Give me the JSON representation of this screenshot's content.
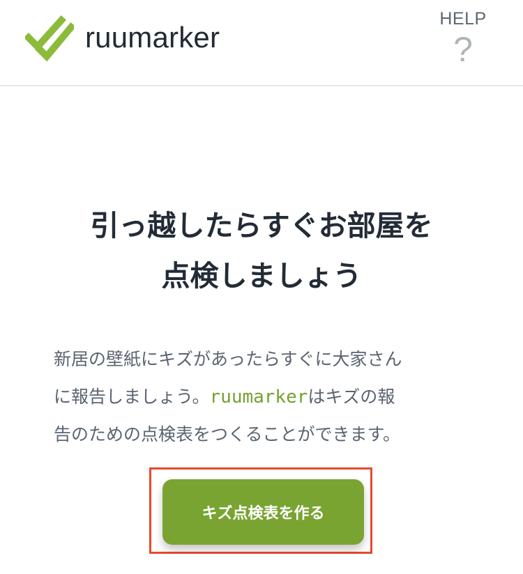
{
  "header": {
    "logo_text": "ruumarker",
    "logo_icon": "double-check-icon",
    "help_label": "HELP",
    "help_icon_text": "?",
    "help_icon": "question-mark-icon"
  },
  "hero": {
    "heading_lines": [
      "引っ越したらすぐお部屋を",
      "点検しましょう"
    ],
    "description": {
      "line1": "新居の壁紙にキズがあったらすぐに大家さん",
      "line2_prefix": "に報告しましょう。",
      "line2_brand": "ruumarker",
      "line2_suffix": "はキズの報",
      "line3": "告のための点検表をつくることができます。"
    },
    "cta_label": "キズ点検表を作る"
  },
  "colors": {
    "brand_green": "#79a432",
    "highlight_red": "#e54b2e",
    "heading_text": "#232b36",
    "body_text": "#5a6470"
  }
}
